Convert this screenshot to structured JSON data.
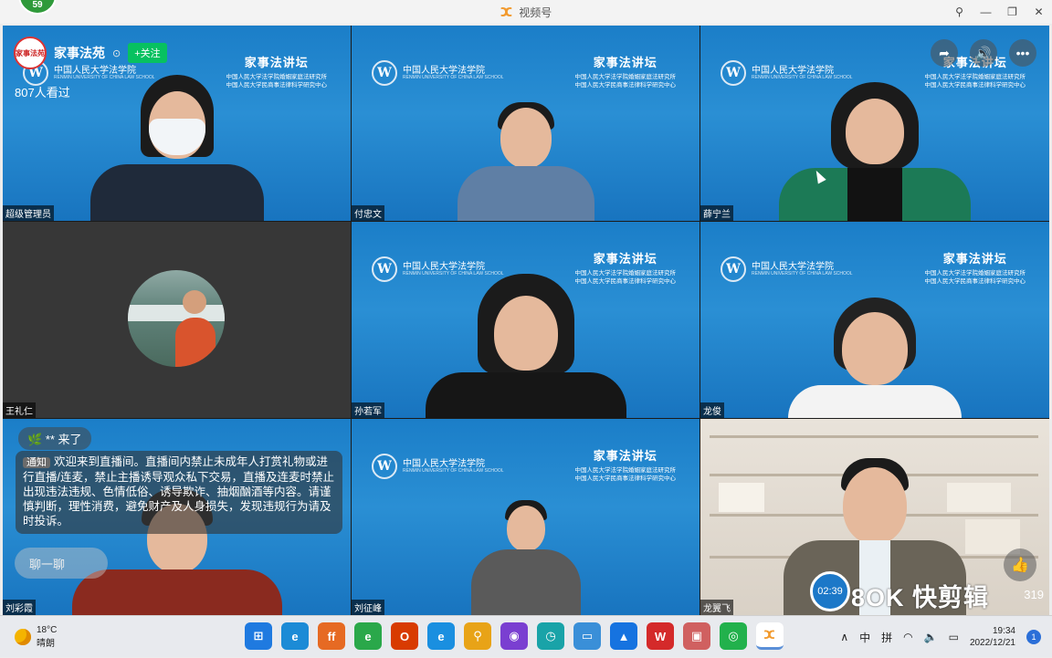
{
  "window": {
    "title": "视频号",
    "badge": "59",
    "controls": [
      "pin",
      "minimize",
      "restore",
      "close"
    ]
  },
  "live": {
    "channel_name": "家事法苑",
    "channel_avatar_text": "家事法苑",
    "follow_label": "+关注",
    "views": "807人看过",
    "arrive_message": "** 来了",
    "notice_tag": "通知",
    "notice_text": "欢迎来到直播间。直播间内禁止未成年人打赏礼物或进行直播/连麦，禁止主播诱导观众私下交易，直播及连麦时禁止出现违法违规、色情低俗、诱导欺诈、抽烟酗酒等内容。请谨慎判断，理性消费，避免财产及人身损失，发现违规行为请及时投诉。",
    "chat_placeholder": "聊一聊",
    "like_count": "319",
    "timer": "02:39",
    "watermark": "8OK 快剪辑"
  },
  "branding": {
    "school": "中国人民大学法学院",
    "school_en": "RENMIN UNIVERSITY OF CHINA LAW SCHOOL",
    "forum_title": "家事法讲坛",
    "forum_line1": "中国人民大学法学院婚姻家庭法研究所",
    "forum_line2": "中国人民大学民商事法律科学研究中心"
  },
  "participants": [
    {
      "name": "超级管理员"
    },
    {
      "name": "付忠文"
    },
    {
      "name": "薛宁兰"
    },
    {
      "name": "王礼仁"
    },
    {
      "name": "孙若军"
    },
    {
      "name": "龙俊"
    },
    {
      "name": "刘彩霞"
    },
    {
      "name": "刘征峰"
    },
    {
      "name": "龙翼飞"
    }
  ],
  "taskbar": {
    "weather_temp": "18°C",
    "weather_desc": "晴朗",
    "ime_lang": "中",
    "ime_mode": "拼",
    "time": "19:34",
    "date": "2022/12/21",
    "notifications": "1"
  }
}
